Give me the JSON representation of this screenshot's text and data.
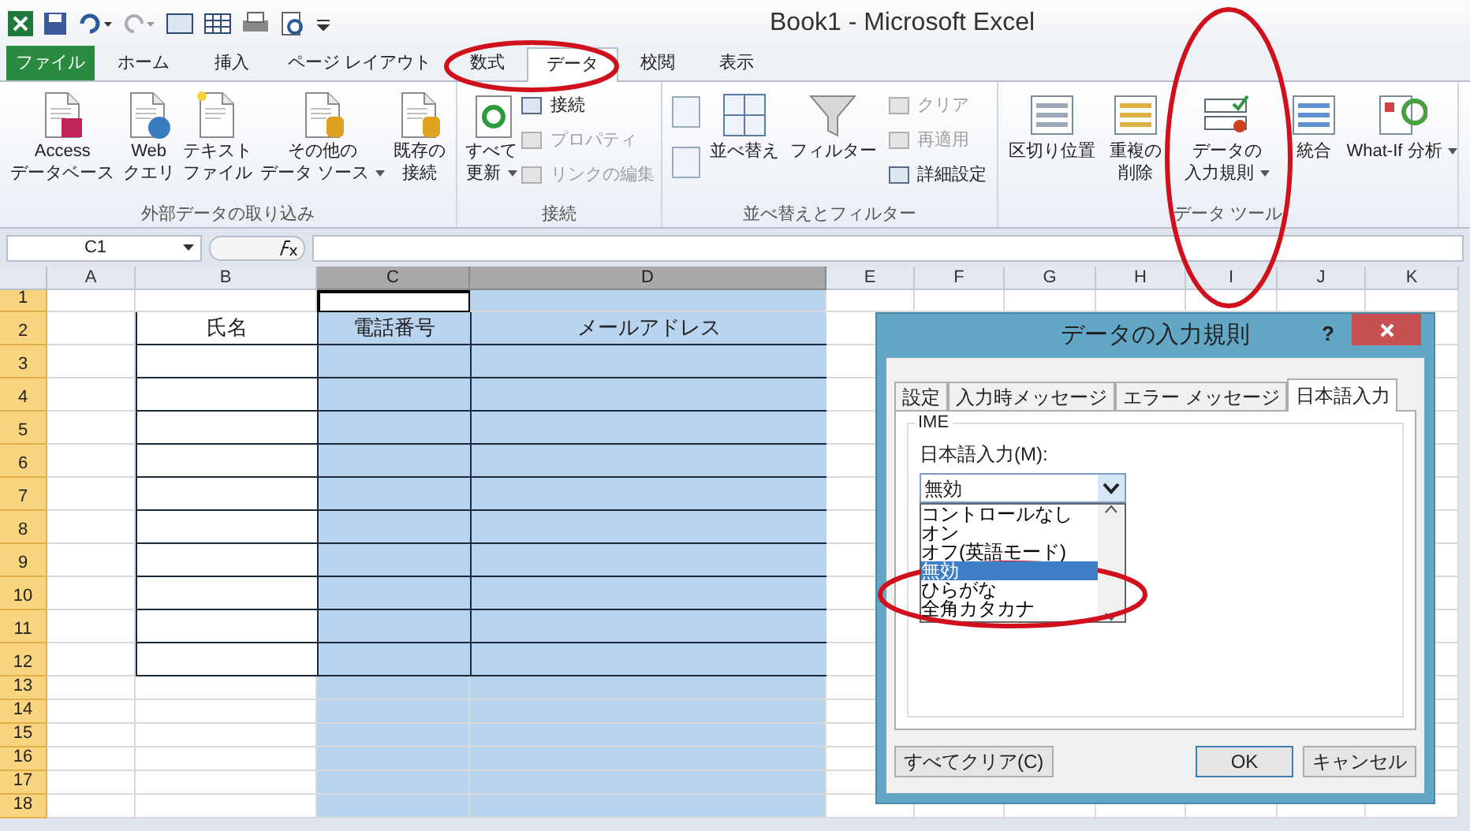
{
  "window": {
    "title": "Book1 - Microsoft Excel"
  },
  "ribbon_tabs": [
    {
      "label": "ファイル",
      "kind": "file",
      "selected": false
    },
    {
      "label": "ホーム",
      "kind": "tab",
      "selected": false
    },
    {
      "label": "挿入",
      "kind": "tab",
      "selected": false
    },
    {
      "label": "ページ レイアウト",
      "kind": "tab",
      "selected": false
    },
    {
      "label": "数式",
      "kind": "tab",
      "selected": false
    },
    {
      "label": "データ",
      "kind": "tab",
      "selected": true
    },
    {
      "label": "校閲",
      "kind": "tab",
      "selected": false
    },
    {
      "label": "表示",
      "kind": "tab",
      "selected": false
    }
  ],
  "ribbon_groups": [
    {
      "label": "外部データの取り込み",
      "items": [
        {
          "kind": "large",
          "lines": [
            "Access",
            "データベース"
          ],
          "dropdown": false,
          "disabled": false
        },
        {
          "kind": "large",
          "lines": [
            "Web",
            "クエリ"
          ],
          "dropdown": false,
          "disabled": false
        },
        {
          "kind": "large",
          "lines": [
            "テキスト",
            "ファイル"
          ],
          "dropdown": false,
          "disabled": false
        },
        {
          "kind": "large",
          "lines": [
            "その他の",
            "データ ソース"
          ],
          "dropdown": true,
          "disabled": false
        },
        {
          "kind": "large",
          "lines": [
            "既存の",
            "接続"
          ],
          "dropdown": false,
          "disabled": false
        }
      ]
    },
    {
      "label": "接続",
      "items": [
        {
          "kind": "large",
          "lines": [
            "すべて",
            "更新"
          ],
          "dropdown": true,
          "disabled": false
        },
        {
          "kind": "stack",
          "entries": [
            {
              "label": "接続",
              "disabled": false
            },
            {
              "label": "プロパティ",
              "disabled": true
            },
            {
              "label": "リンクの編集",
              "disabled": true
            }
          ]
        }
      ]
    },
    {
      "label": "並べ替えとフィルター",
      "items": [
        {
          "kind": "sortpair"
        },
        {
          "kind": "large",
          "lines": [
            "並べ替え"
          ],
          "dropdown": false,
          "disabled": false
        },
        {
          "kind": "large",
          "lines": [
            "フィルター"
          ],
          "dropdown": false,
          "disabled": false
        },
        {
          "kind": "stack",
          "entries": [
            {
              "label": "クリア",
              "disabled": true
            },
            {
              "label": "再適用",
              "disabled": true
            },
            {
              "label": "詳細設定",
              "disabled": false
            }
          ]
        }
      ]
    },
    {
      "label": "データ ツール",
      "items": [
        {
          "kind": "large",
          "lines": [
            "区切り位置"
          ],
          "dropdown": false,
          "disabled": false
        },
        {
          "kind": "large",
          "lines": [
            "重複の",
            "削除"
          ],
          "dropdown": false,
          "disabled": false
        },
        {
          "kind": "large",
          "lines": [
            "データの",
            "入力規則"
          ],
          "dropdown": true,
          "disabled": false
        },
        {
          "kind": "large",
          "lines": [
            "統合"
          ],
          "dropdown": false,
          "disabled": false
        },
        {
          "kind": "large",
          "lines": [
            "What-If 分析"
          ],
          "dropdown": true,
          "disabled": false
        }
      ]
    }
  ],
  "formula_bar": {
    "name_box": "C1"
  },
  "sheet": {
    "columns": [
      {
        "label": "A",
        "selected": false
      },
      {
        "label": "B",
        "selected": false
      },
      {
        "label": "C",
        "selected": true
      },
      {
        "label": "D",
        "selected": true
      },
      {
        "label": "E",
        "selected": false
      },
      {
        "label": "F",
        "selected": false
      },
      {
        "label": "G",
        "selected": false
      },
      {
        "label": "H",
        "selected": false
      },
      {
        "label": "I",
        "selected": false
      },
      {
        "label": "J",
        "selected": false
      },
      {
        "label": "K",
        "selected": false
      }
    ],
    "rows": [
      {
        "label": "1",
        "selected": true
      },
      {
        "label": "2",
        "selected": true
      },
      {
        "label": "3",
        "selected": true
      },
      {
        "label": "4",
        "selected": true
      },
      {
        "label": "5",
        "selected": true
      },
      {
        "label": "6",
        "selected": true
      },
      {
        "label": "7",
        "selected": true
      },
      {
        "label": "8",
        "selected": true
      },
      {
        "label": "9",
        "selected": true
      },
      {
        "label": "10",
        "selected": true
      },
      {
        "label": "11",
        "selected": true
      },
      {
        "label": "12",
        "selected": true
      },
      {
        "label": "13",
        "selected": true
      },
      {
        "label": "14",
        "selected": true
      },
      {
        "label": "15",
        "selected": true
      },
      {
        "label": "16",
        "selected": true
      },
      {
        "label": "17",
        "selected": true
      },
      {
        "label": "18",
        "selected": true
      }
    ],
    "table_headers": [
      "氏名",
      "電話番号",
      "メールアドレス"
    ]
  },
  "dialog": {
    "title": "データの入力規則",
    "help": "?",
    "tabs": [
      {
        "label": "設定",
        "selected": false
      },
      {
        "label": "入力時メッセージ",
        "selected": false
      },
      {
        "label": "エラー メッセージ",
        "selected": false
      },
      {
        "label": "日本語入力",
        "selected": true
      }
    ],
    "group_title": "IME",
    "field_label": "日本語入力(M):",
    "value": "無効",
    "options": [
      {
        "label": "コントロールなし",
        "selected": false
      },
      {
        "label": "オン",
        "selected": false
      },
      {
        "label": "オフ(英語モード)",
        "selected": false
      },
      {
        "label": "無効",
        "selected": true
      },
      {
        "label": "ひらがな",
        "selected": false
      },
      {
        "label": "全角カタカナ",
        "selected": false
      }
    ],
    "buttons": [
      {
        "label": "すべてクリア(C)",
        "default": false
      },
      {
        "label": "OK",
        "default": true
      },
      {
        "label": "キャンセル",
        "default": false
      }
    ]
  },
  "annotations": [
    {
      "kind": "ellipse"
    },
    {
      "kind": "ellipse"
    },
    {
      "kind": "ellipse"
    }
  ]
}
